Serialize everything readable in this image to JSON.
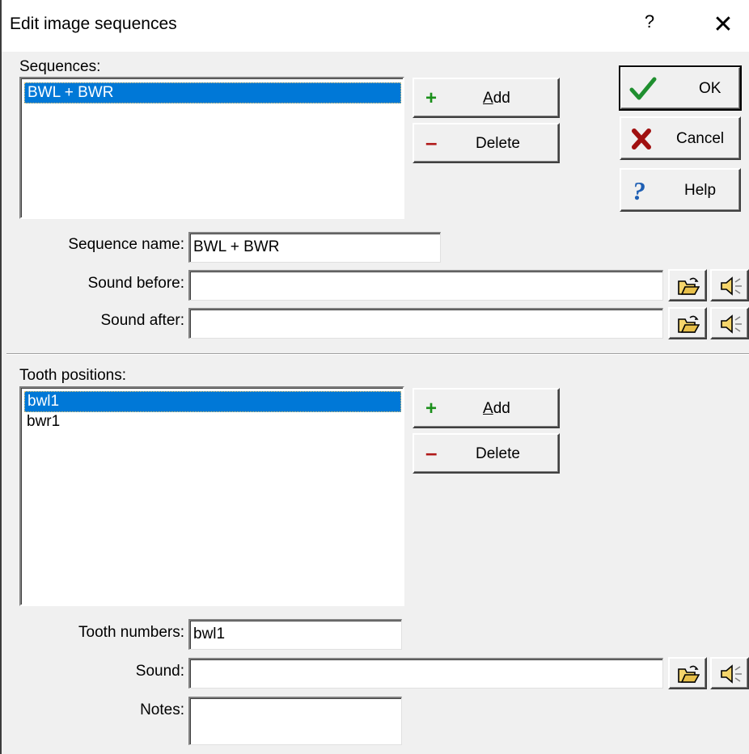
{
  "window": {
    "title": "Edit image sequences",
    "help_glyph": "?",
    "close_glyph": "✕"
  },
  "sequences": {
    "label": "Sequences:",
    "items": [
      "BWL + BWR"
    ],
    "selected_index": 0,
    "add_label": "Add",
    "add_hotkey": "A",
    "delete_label": "Delete"
  },
  "dialog_buttons": {
    "ok": "OK",
    "cancel": "Cancel",
    "help": "Help"
  },
  "sequence_fields": {
    "name_label": "Sequence name:",
    "name_value": "BWL + BWR",
    "sound_before_label": "Sound before:",
    "sound_before_value": "",
    "sound_after_label": "Sound after:",
    "sound_after_value": ""
  },
  "tooth_positions": {
    "label": "Tooth positions:",
    "items": [
      "bwl1",
      "bwr1"
    ],
    "selected_index": 0,
    "add_label": "Add",
    "delete_label": "Delete"
  },
  "tooth_fields": {
    "numbers_label": "Tooth numbers:",
    "numbers_value": "bwl1",
    "sound_label": "Sound:",
    "sound_value": "",
    "notes_label": "Notes:",
    "notes_value": ""
  },
  "icons": {
    "add": "plus-icon",
    "delete": "minus-icon",
    "ok": "checkmark-icon",
    "cancel": "red-x-icon",
    "help": "question-mark-icon",
    "browse": "open-folder-icon",
    "play": "speaker-icon"
  },
  "colors": {
    "selection": "#0078d7",
    "plus": "#1a8f1a",
    "minus": "#b01818",
    "check": "#1f8f2f",
    "cancel_x": "#a01010",
    "help_q": "#1e5fb4"
  }
}
